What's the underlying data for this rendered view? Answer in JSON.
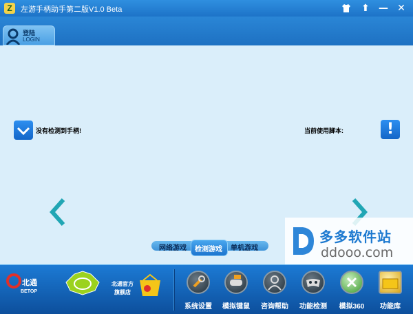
{
  "window": {
    "title": "左游手柄助手第二版V1.0 Beta",
    "app_icon_glyph": "Z"
  },
  "controls": {
    "pin_glyph": "⬆",
    "min_glyph": "—",
    "close_glyph": "✕"
  },
  "login_tab": {
    "label_cn": "登陆",
    "label_en": "LOGIN",
    "icon": "user-icon"
  },
  "status": {
    "left_text": "没有检测到手柄!",
    "right_text": "当前使用脚本:",
    "alert_glyph": "!"
  },
  "mode_tabs": {
    "items": [
      "网络游戏",
      "检测游戏",
      "单机游戏"
    ],
    "active_index": 1
  },
  "watermark": {
    "cn": "多多软件站",
    "en": "ddooo.com"
  },
  "brands": {
    "store_text_line1": "北通官方",
    "store_text_line2": "旗舰店",
    "betop_cn": "北通",
    "betop_en": "BETOP"
  },
  "toolbar": {
    "items": [
      {
        "label": "系统设置",
        "icon": "wrench-icon"
      },
      {
        "label": "模拟键鼠",
        "icon": "gamepad-keyboard-icon"
      },
      {
        "label": "咨询帮助",
        "icon": "help-user-icon"
      },
      {
        "label": "功能检测",
        "icon": "gamepad-icon"
      },
      {
        "label": "模拟360",
        "icon": "xbox-icon"
      },
      {
        "label": "功能库",
        "icon": "folder-icon"
      }
    ]
  },
  "colors": {
    "accent": "#1e73c8",
    "background": "#daeefa",
    "arrow": "#21a6b4"
  }
}
